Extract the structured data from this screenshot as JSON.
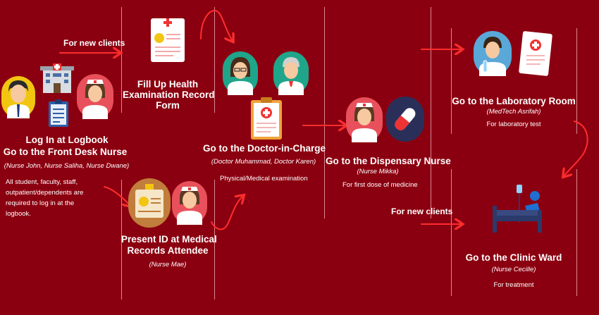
{
  "colors": {
    "background": "#8b0010",
    "arrow": "#ff2d2d",
    "divider": "#d98890"
  },
  "steps": {
    "login": {
      "title_line1": "Log In at Logbook",
      "title_line2": "Go to the Front Desk Nurse",
      "staff": "(Nurse John, Nurse Saliha, Nurse Dwane)",
      "note_lines": [
        "All student, faculty, staff,",
        "outpatient/dependents are",
        "required to log in at the",
        "logbook."
      ]
    },
    "fill_up": {
      "label": "For new clients",
      "title_lines": [
        "Fill Up Health",
        "Examination Record",
        "Form"
      ]
    },
    "present_id": {
      "title_lines": [
        "Present ID at Medical",
        "Records Attendee"
      ],
      "staff": "(Nurse Mae)"
    },
    "doctor": {
      "title": "Go to the Doctor-in-Charge",
      "staff": "(Doctor Muhammad, Doctor Karen)",
      "note": "Physical/Medical examination"
    },
    "dispensary": {
      "title": "Go to the Dispensary Nurse",
      "staff": "(Nurse Mikka)",
      "note": "For first dose of medicine"
    },
    "laboratory": {
      "title": "Go to the Laboratory Room",
      "staff": "(MedTech Asrifah)",
      "note": "For laboratory test"
    },
    "clinic_ward": {
      "label": "For new clients",
      "title": "Go to the Clinic Ward",
      "staff": "(Nurse Cecille)",
      "note": "For treatment"
    }
  },
  "icons": [
    "male-staff-icon",
    "hospital-building-icon",
    "clipboard-icon",
    "nurse-icon",
    "health-form-icon",
    "id-card-icon",
    "female-doctor-icon",
    "male-doctor-icon",
    "medical-clipboard-icon",
    "pill-capsule-icon",
    "lab-technician-icon",
    "lab-report-icon",
    "hospital-bed-patient-icon"
  ]
}
